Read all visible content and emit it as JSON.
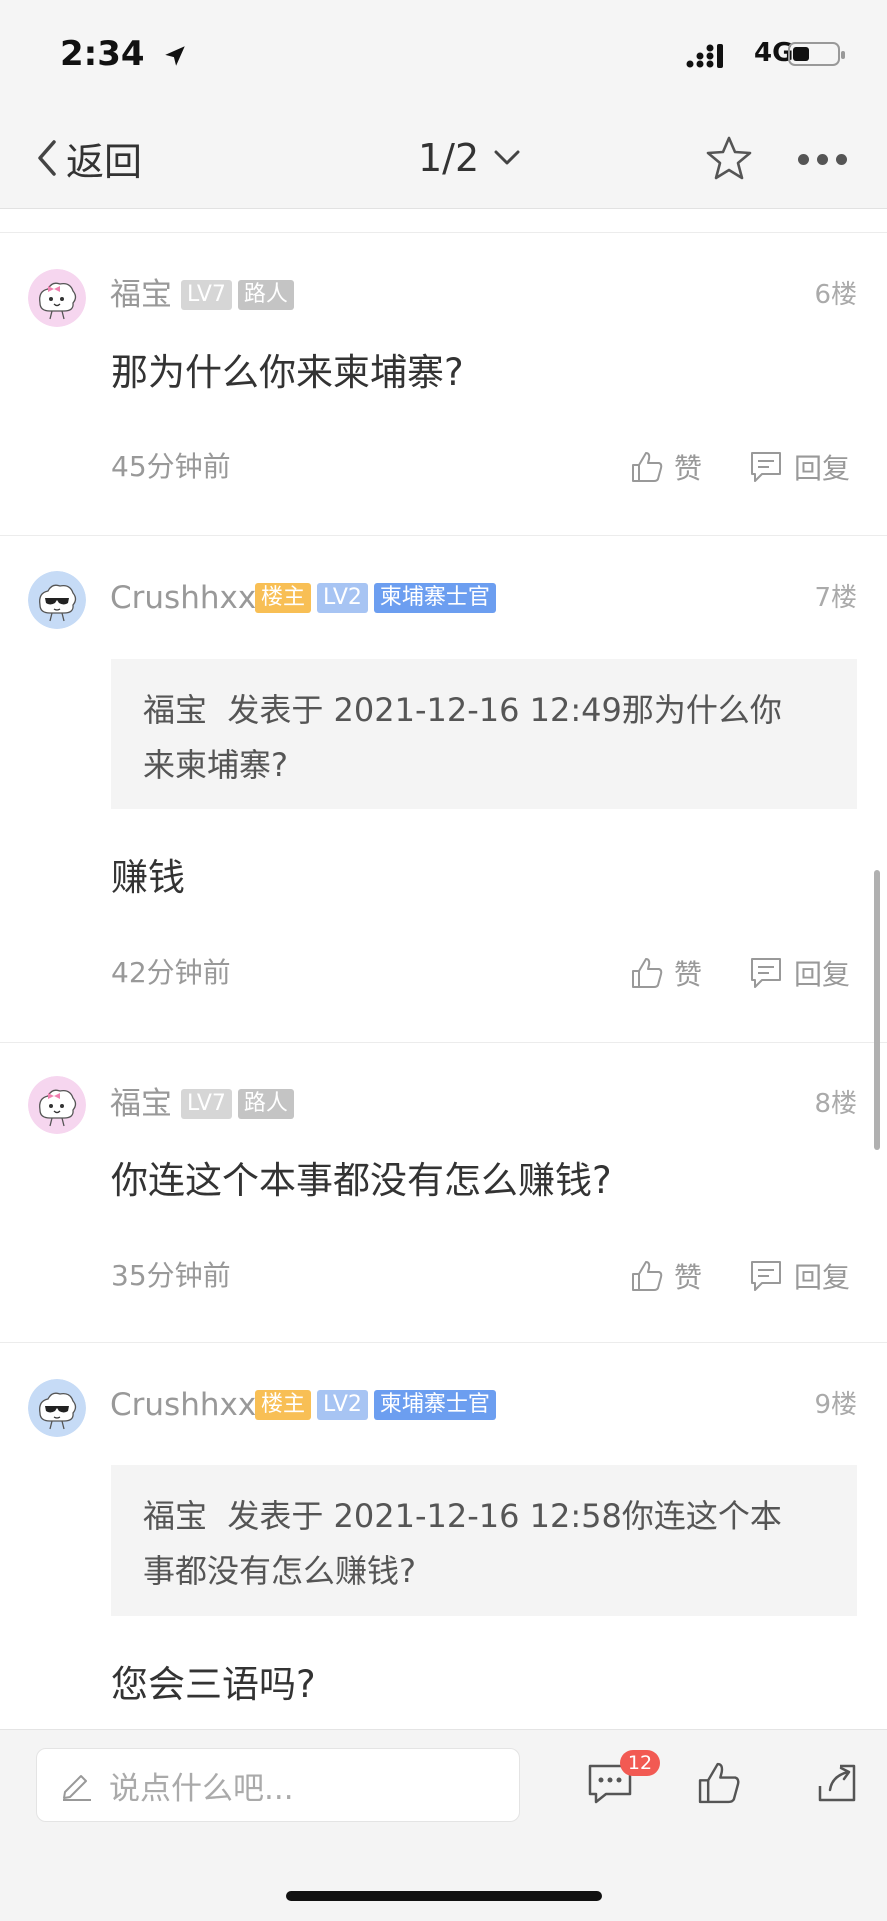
{
  "status": {
    "time": "2:34",
    "network": "4G"
  },
  "nav": {
    "back_label": "返回",
    "page_indicator": "1/2"
  },
  "posts": [
    {
      "username": "福宝",
      "tags": [
        "LV7",
        "路人"
      ],
      "floor": "6楼",
      "content": "那为什么你来柬埔寨?",
      "time": "45分钟前",
      "like_label": "赞",
      "reply_label": "回复"
    },
    {
      "username": "Crushhxx",
      "tags": [
        "楼主",
        "LV2",
        "柬埔寨士官"
      ],
      "floor": "7楼",
      "quote_line1": "福宝  发表于 2021-12-16 12:49那为什么你",
      "quote_line2": "来柬埔寨?",
      "content": "赚钱",
      "time": "42分钟前",
      "like_label": "赞",
      "reply_label": "回复"
    },
    {
      "username": "福宝",
      "tags": [
        "LV7",
        "路人"
      ],
      "floor": "8楼",
      "content": "你连这个本事都没有怎么赚钱?",
      "time": "35分钟前",
      "like_label": "赞",
      "reply_label": "回复"
    },
    {
      "username": "Crushhxx",
      "tags": [
        "楼主",
        "LV2",
        "柬埔寨士官"
      ],
      "floor": "9楼",
      "quote_line1": "福宝  发表于 2021-12-16 12:58你连这个本",
      "quote_line2": "事都没有怎么赚钱?",
      "content": "您会三语吗?"
    }
  ],
  "bottom_bar": {
    "input_placeholder": "说点什么吧...",
    "comment_count": "12"
  },
  "colors": {
    "owner_tag": "#f8bf55",
    "level_tag": "#a7c4f3",
    "title_tag": "#6c9ef0",
    "badge": "#f25a53"
  }
}
